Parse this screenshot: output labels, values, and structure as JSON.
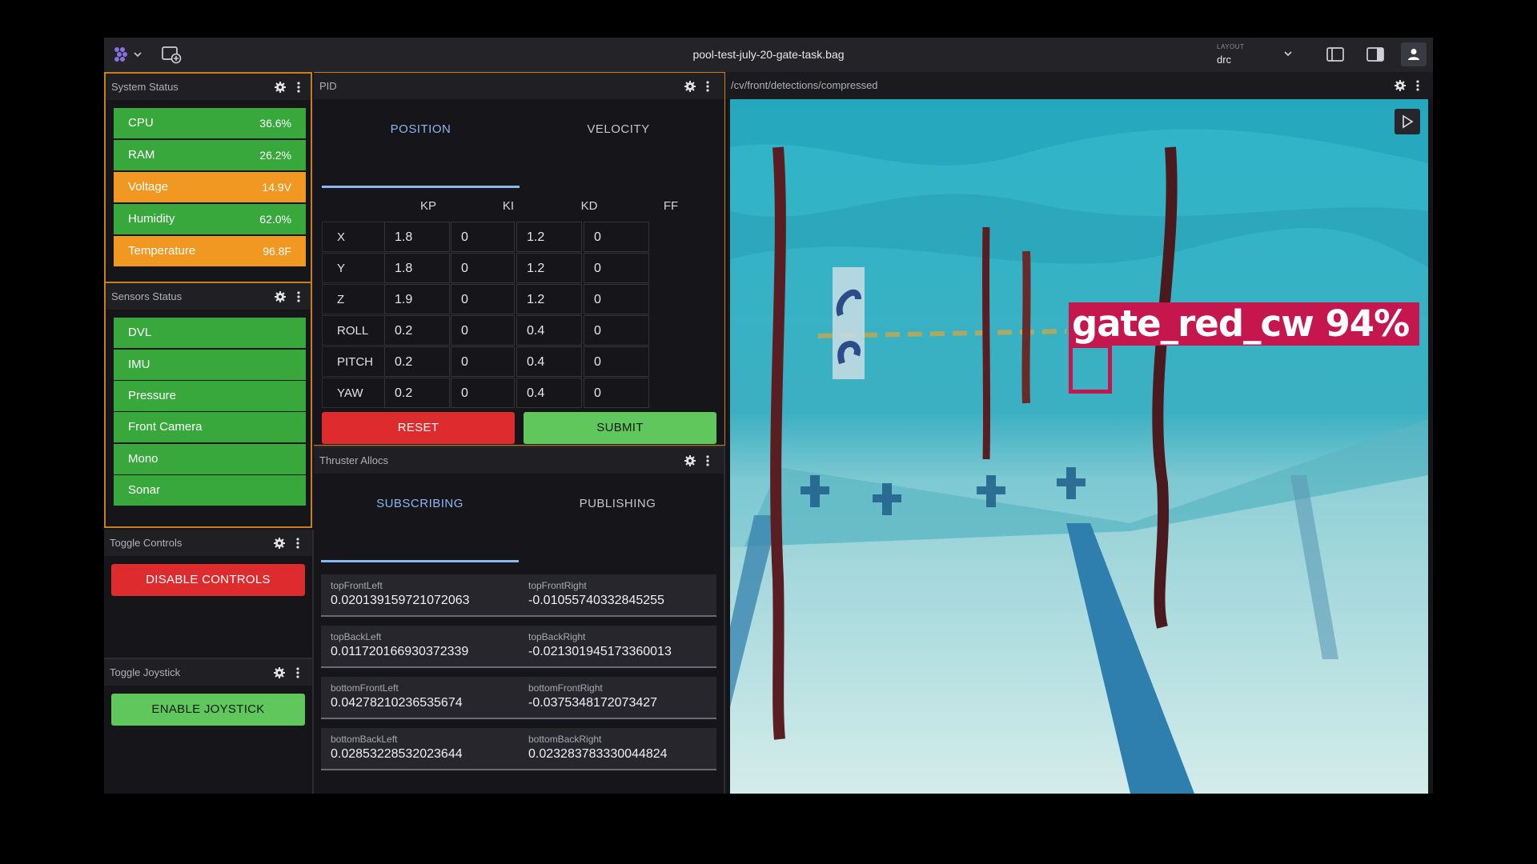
{
  "app": {
    "file_title": "pool-test-july-20-gate-task.bag",
    "layout_label": "LAYOUT",
    "layout_value": "drc"
  },
  "system_status": {
    "title": "System Status",
    "rows": [
      {
        "name": "CPU",
        "value": "36.6%",
        "color": "#38a83c"
      },
      {
        "name": "RAM",
        "value": "26.2%",
        "color": "#38a83c"
      },
      {
        "name": "Voltage",
        "value": "14.9V",
        "color": "#f09822"
      },
      {
        "name": "Humidity",
        "value": "62.0%",
        "color": "#38a83c"
      },
      {
        "name": "Temperature",
        "value": "96.8F",
        "color": "#f09822"
      }
    ]
  },
  "sensors_status": {
    "title": "Sensors Status",
    "items": [
      "DVL",
      "IMU",
      "Pressure",
      "Front Camera",
      "Mono",
      "Sonar"
    ]
  },
  "toggle_controls": {
    "title": "Toggle Controls",
    "button": "DISABLE CONTROLS"
  },
  "toggle_joystick": {
    "title": "Toggle Joystick",
    "button": "ENABLE JOYSTICK"
  },
  "pid": {
    "title": "PID",
    "tabs": [
      "POSITION",
      "VELOCITY"
    ],
    "active_tab": "POSITION",
    "columns": [
      "KP",
      "KI",
      "KD",
      "FF"
    ],
    "rows": [
      {
        "label": "X",
        "values": [
          "1.8",
          "0",
          "1.2",
          "0"
        ]
      },
      {
        "label": "Y",
        "values": [
          "1.8",
          "0",
          "1.2",
          "0"
        ]
      },
      {
        "label": "Z",
        "values": [
          "1.9",
          "0",
          "1.2",
          "0"
        ]
      },
      {
        "label": "ROLL",
        "values": [
          "0.2",
          "0",
          "0.4",
          "0"
        ]
      },
      {
        "label": "PITCH",
        "values": [
          "0.2",
          "0",
          "0.4",
          "0"
        ]
      },
      {
        "label": "YAW",
        "values": [
          "0.2",
          "0",
          "0.4",
          "0"
        ]
      }
    ],
    "reset_label": "RESET",
    "submit_label": "SUBMIT"
  },
  "thruster": {
    "title": "Thruster Allocs",
    "tabs": [
      "SUBSCRIBING",
      "PUBLISHING"
    ],
    "active_tab": "SUBSCRIBING",
    "cards": [
      [
        {
          "k": "topFrontLeft",
          "v": "0.020139159721072063"
        },
        {
          "k": "topFrontRight",
          "v": "-0.01055740332845255"
        }
      ],
      [
        {
          "k": "topBackLeft",
          "v": "0.011720166930372339"
        },
        {
          "k": "topBackRight",
          "v": "-0.02130194517336001​3"
        }
      ],
      [
        {
          "k": "bottomFrontLeft",
          "v": "0.04278210236535674"
        },
        {
          "k": "bottomFrontRight",
          "v": "-0.0375348172073427"
        }
      ],
      [
        {
          "k": "bottomBackLeft",
          "v": "0.02853228532023644"
        },
        {
          "k": "bottomBackRight",
          "v": "0.023283783330044824"
        }
      ]
    ]
  },
  "camera": {
    "topic": "/cv/front/detections/compressed",
    "detection_label": "gate_red_cw  94%",
    "detection_color": "#c5174e"
  }
}
